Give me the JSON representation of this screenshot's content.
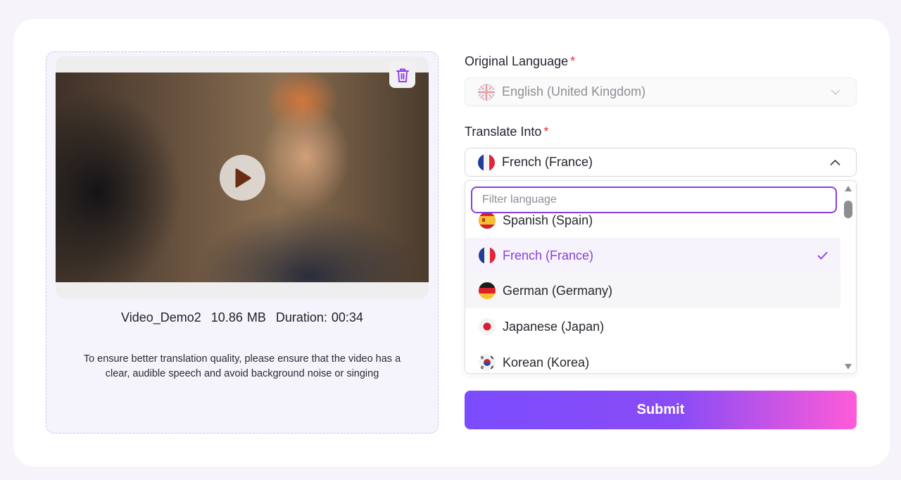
{
  "upload": {
    "file_name": "Video_Demo2",
    "file_size": "10.86 MB",
    "duration": "Duration: 00:34",
    "note": "To ensure better translation quality, please ensure that the video has a clear, audible speech and avoid background noise or singing"
  },
  "form": {
    "original_language_label": "Original Language",
    "translate_into_label": "Translate Into",
    "required_mark": "*",
    "original_language_value": "English (United Kingdom)",
    "translate_into_value": "French (France)",
    "filter_placeholder": "Filter language",
    "options": [
      {
        "label": "Spanish (Spain)",
        "flag": "es-flag-icon"
      },
      {
        "label": "French (France)",
        "flag": "fr-flag-icon",
        "selected": true
      },
      {
        "label": "German (Germany)",
        "flag": "de-flag-icon"
      },
      {
        "label": "Japanese (Japan)",
        "flag": "jp-flag-icon"
      },
      {
        "label": "Korean (Korea)",
        "flag": "kr-flag-icon"
      }
    ],
    "submit_label": "Submit"
  },
  "colors": {
    "accent": "#8a3ee0",
    "required": "#e5323c",
    "submit_gradient_start": "#7b4cff",
    "submit_gradient_end": "#ff5bd8"
  }
}
